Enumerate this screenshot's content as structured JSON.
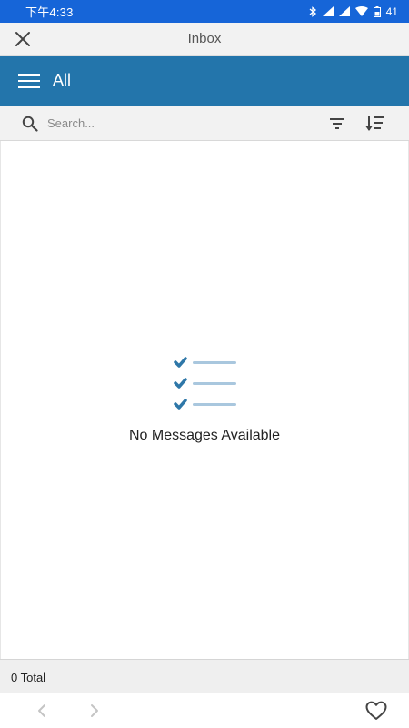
{
  "status_bar": {
    "time": "下午4:33",
    "battery": "41"
  },
  "title_bar": {
    "title": "Inbox"
  },
  "header": {
    "title": "All"
  },
  "search": {
    "placeholder": "Search..."
  },
  "empty_state": {
    "message": "No Messages Available"
  },
  "footer": {
    "total": "0 Total"
  },
  "colors": {
    "status_bar": "#1665d8",
    "header": "#2375ab",
    "check_accent": "#2e77a8",
    "line_accent": "#a9c7de"
  },
  "icons": {
    "close": "close-icon",
    "menu": "menu-icon",
    "search": "search-icon",
    "filter": "filter-icon",
    "sort": "sort-icon",
    "empty": "checklist-icon",
    "back": "back-icon",
    "forward": "forward-icon",
    "favorite": "heart-icon"
  }
}
